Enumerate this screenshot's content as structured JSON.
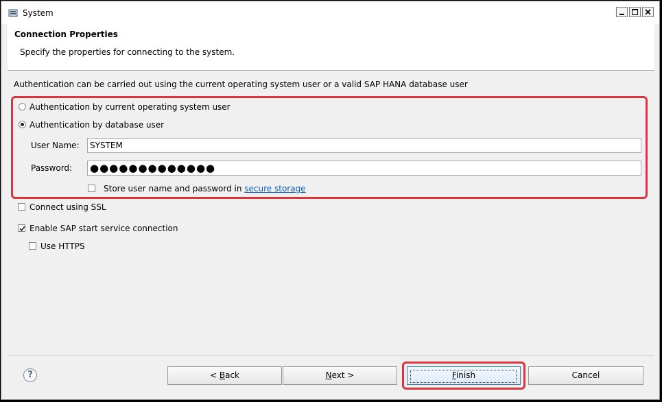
{
  "window": {
    "title": "System"
  },
  "header": {
    "title": "Connection Properties",
    "description": "Specify the properties for connecting to the system."
  },
  "intro_text": "Authentication can be carried out using the current operating system user or a valid SAP HANA database user",
  "auth": {
    "option_os_user": "Authentication by current operating system user",
    "option_db_user": "Authentication by database user",
    "selected": "db_user",
    "user_name_label": "User Name:",
    "user_name_value": "SYSTEM",
    "password_label": "Password:",
    "password_value": "●●●●●●●●●●●●●",
    "store_label_prefix": "Store user name and password in ",
    "store_link": "secure storage",
    "store_checked": false
  },
  "options": {
    "ssl_label": "Connect using SSL",
    "ssl_checked": false,
    "start_service_label": "Enable SAP start service connection",
    "start_service_checked": true,
    "https_label": "Use HTTPS",
    "https_checked": false
  },
  "footer": {
    "help": "?",
    "back_mnemonic": "B",
    "back_rest": "ack",
    "next_mnemonic": "N",
    "next_rest": "ext >",
    "finish_mnemonic": "F",
    "finish_rest": "inish",
    "cancel": "Cancel"
  },
  "colors": {
    "highlight": "#d9363e",
    "link": "#0a5ec9"
  }
}
